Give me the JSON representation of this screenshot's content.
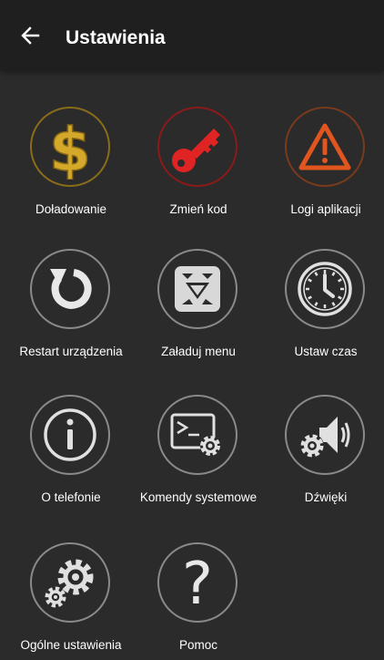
{
  "appbar": {
    "title": "Ustawienia",
    "back_icon": "arrow-left-icon"
  },
  "colors": {
    "background": "#2b2b2b",
    "appbar": "#1f1f1f",
    "gold": "#c9a227",
    "red": "#cc1f1f",
    "orange": "#d9531e",
    "icon_gray": "#bdbdbd"
  },
  "tiles": [
    {
      "label": "Doładowanie",
      "icon": "dollar-icon"
    },
    {
      "label": "Zmień kod",
      "icon": "key-icon"
    },
    {
      "label": "Logi aplikacji",
      "icon": "warning-icon"
    },
    {
      "label": "Restart urządzenia",
      "icon": "restart-icon"
    },
    {
      "label": "Załaduj menu",
      "icon": "load-menu-icon"
    },
    {
      "label": "Ustaw czas",
      "icon": "clock-icon"
    },
    {
      "label": "O telefonie",
      "icon": "info-icon"
    },
    {
      "label": "Komendy systemowe",
      "icon": "terminal-gear-icon"
    },
    {
      "label": "Dźwięki",
      "icon": "sound-gear-icon"
    },
    {
      "label": "Ogólne ustawienia",
      "icon": "gears-icon"
    },
    {
      "label": "Pomoc",
      "icon": "help-icon"
    }
  ]
}
